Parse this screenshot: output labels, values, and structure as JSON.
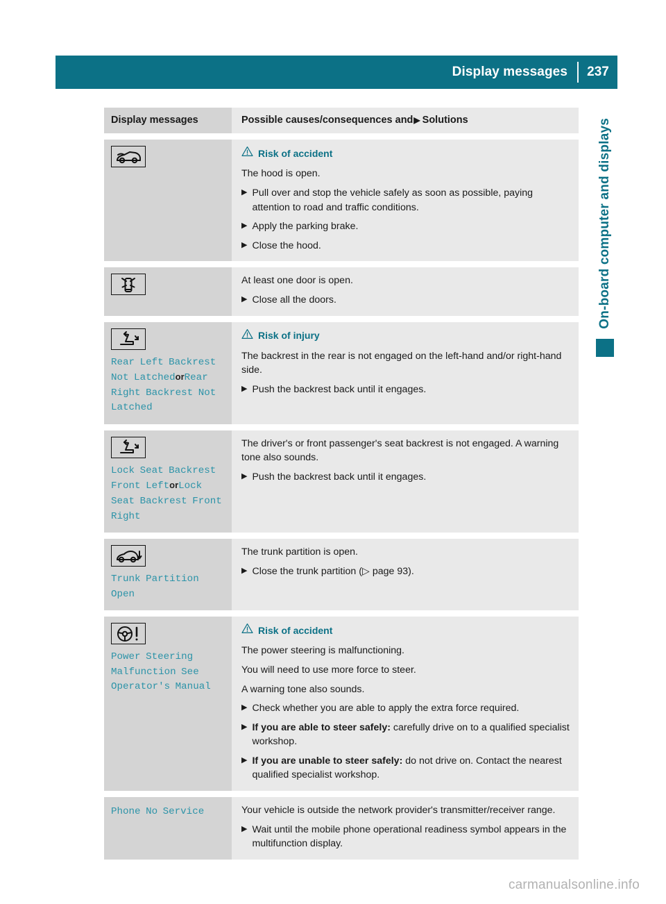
{
  "header": {
    "title": "Display messages",
    "page_number": "237",
    "bg_color": "#0c7186"
  },
  "side_tab": {
    "label": "On-board computer and displays",
    "color": "#0c7186"
  },
  "table": {
    "col1_header": "Display messages",
    "col2_header_before": "Possible causes/consequences and",
    "col2_header_arrow": "▶",
    "col2_header_after": "Solutions"
  },
  "rows": [
    {
      "icon": "car-hood-open-icon",
      "message": null,
      "warning": {
        "icon": "warning-triangle-icon",
        "title": "Risk of accident"
      },
      "paragraphs": [
        "The hood is open."
      ],
      "steps": [
        {
          "text": "Pull over and stop the vehicle safely as soon as possible, paying attention to road and traffic conditions."
        },
        {
          "text": "Apply the parking brake."
        },
        {
          "text": "Close the hood."
        }
      ]
    },
    {
      "icon": "car-doors-open-icon",
      "message": null,
      "warning": null,
      "paragraphs": [
        "At least one door is open."
      ],
      "steps": [
        {
          "text": "Close all the doors."
        }
      ]
    },
    {
      "icon": "seat-backrest-icon",
      "message_parts": [
        {
          "type": "code",
          "text": "Rear Left Backrest Not Latched"
        },
        {
          "type": "or",
          "text": "or"
        },
        {
          "type": "code",
          "text": "Rear Right Backrest Not Latched"
        }
      ],
      "warning": {
        "icon": "warning-triangle-icon",
        "title": "Risk of injury"
      },
      "paragraphs": [
        "The backrest in the rear is not engaged on the left-hand and/or right-hand side."
      ],
      "steps": [
        {
          "text": "Push the backrest back until it engages."
        }
      ]
    },
    {
      "icon": "seat-backrest-icon",
      "message_parts": [
        {
          "type": "code",
          "text": "Lock Seat Backrest Front Left"
        },
        {
          "type": "or",
          "text": "or"
        },
        {
          "type": "code",
          "text": "Lock Seat Backrest Front Right"
        }
      ],
      "warning": null,
      "paragraphs": [
        "The driver's or front passenger's seat backrest is not engaged. A warning tone also sounds."
      ],
      "steps": [
        {
          "text": "Push the backrest back until it engages."
        }
      ]
    },
    {
      "icon": "trunk-partition-icon",
      "message_parts": [
        {
          "type": "code",
          "text": "Trunk Partition Open"
        }
      ],
      "warning": null,
      "paragraphs": [
        "The trunk partition is open."
      ],
      "steps": [
        {
          "text": "Close the trunk partition (▷ page 93)."
        }
      ]
    },
    {
      "icon": "power-steering-warning-icon",
      "message_parts": [
        {
          "type": "code",
          "text": "Power Steering Malfunction See Operator's Manual"
        }
      ],
      "warning": {
        "icon": "warning-triangle-icon",
        "title": "Risk of accident"
      },
      "paragraphs": [
        "The power steering is malfunctioning.",
        "You will need to use more force to steer.",
        "A warning tone also sounds."
      ],
      "steps": [
        {
          "text": "Check whether you are able to apply the extra force required."
        },
        {
          "bold": "If you are able to steer safely:",
          "text": " carefully drive on to a qualified specialist workshop."
        },
        {
          "bold": "If you are unable to steer safely:",
          "text": " do not drive on. Contact the nearest qualified specialist workshop."
        }
      ]
    },
    {
      "icon": null,
      "message_parts": [
        {
          "type": "code",
          "text": "Phone No Service"
        }
      ],
      "warning": null,
      "paragraphs": [
        "Your vehicle is outside the network provider's transmitter/receiver range."
      ],
      "steps": [
        {
          "text": "Wait until the mobile phone operational readiness symbol appears in the multifunction display."
        }
      ]
    }
  ],
  "watermark": "carmanualsonline.info"
}
